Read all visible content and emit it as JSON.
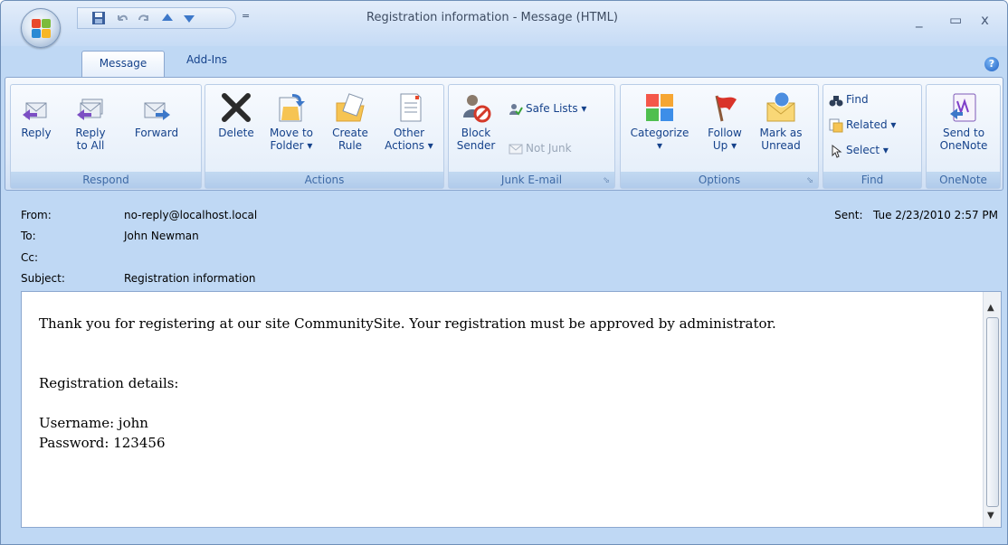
{
  "window": {
    "title": "Registration information - Message (HTML)"
  },
  "quick_access": {
    "customize": "="
  },
  "tabs": [
    "Message",
    "Add-Ins"
  ],
  "ribbon": {
    "respond": {
      "label": "Respond",
      "reply": "Reply",
      "reply_all_1": "Reply",
      "reply_all_2": "to All",
      "forward": "Forward"
    },
    "actions": {
      "label": "Actions",
      "delete": "Delete",
      "move_1": "Move to",
      "move_2": "Folder ▾",
      "create_1": "Create",
      "create_2": "Rule",
      "other_1": "Other",
      "other_2": "Actions ▾"
    },
    "junk": {
      "label": "Junk E-mail",
      "block_1": "Block",
      "block_2": "Sender",
      "safe_lists": "Safe Lists ▾",
      "not_junk": "Not Junk"
    },
    "options": {
      "label": "Options",
      "categorize": "Categorize",
      "categorize_2": "▾",
      "follow_1": "Follow",
      "follow_2": "Up ▾",
      "mark_1": "Mark as",
      "mark_2": "Unread"
    },
    "find": {
      "label": "Find",
      "find": "Find",
      "related": "Related ▾",
      "select": "Select ▾"
    },
    "onenote": {
      "label": "OneNote",
      "send_1": "Send to",
      "send_2": "OneNote"
    }
  },
  "header": {
    "from_label": "From:",
    "from": "no-reply@localhost.local",
    "to_label": "To:",
    "to": "John Newman",
    "cc_label": "Cc:",
    "cc": "",
    "subject_label": "Subject:",
    "subject": "Registration information",
    "sent_label": "Sent:",
    "sent": "Tue 2/23/2010 2:57 PM"
  },
  "body": {
    "line1": "Thank you for registering at our site CommunitySite. Your registration must be approved by administrator.",
    "line2": "Registration details:",
    "line3": "Username: john",
    "line4": "Password: 123456"
  },
  "colors": {
    "accent": "#15428b",
    "ribbon_bg": "#dfeaf8",
    "frame": "#bfd8f4"
  }
}
